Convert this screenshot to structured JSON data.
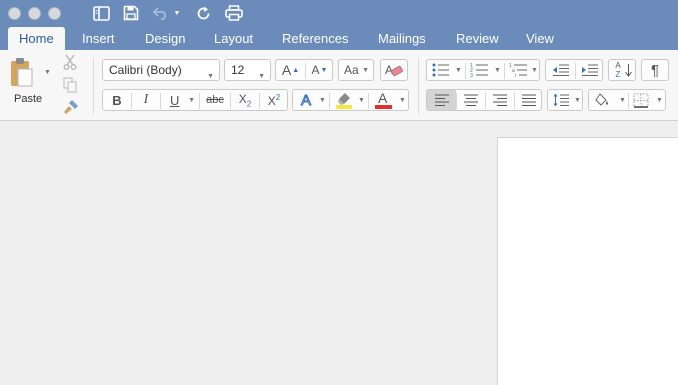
{
  "window": {
    "traffic_lights": [
      "close",
      "minimize",
      "zoom"
    ],
    "quick_access": [
      "sidebar-icon",
      "save-icon",
      "undo-icon",
      "redo-icon",
      "print-icon"
    ]
  },
  "tabs": [
    {
      "label": "Home",
      "active": true
    },
    {
      "label": "Insert"
    },
    {
      "label": "Design"
    },
    {
      "label": "Layout"
    },
    {
      "label": "References"
    },
    {
      "label": "Mailings"
    },
    {
      "label": "Review"
    },
    {
      "label": "View"
    }
  ],
  "clipboard": {
    "paste_label": "Paste"
  },
  "font": {
    "name": "Calibri (Body)",
    "size": "12",
    "bold_glyph": "B",
    "italic_glyph": "I",
    "underline_glyph": "U",
    "strike_glyph": "abc",
    "subscript_base": "X",
    "subscript_mark": "2",
    "superscript_base": "X",
    "superscript_mark": "2",
    "grow_glyph": "A",
    "shrink_glyph": "A",
    "case_glyph": "Aa",
    "effects_glyph": "A",
    "color_glyph": "A",
    "sort_top": "A",
    "sort_bottom": "Z",
    "highlight_color": "#f5ea3c",
    "font_color": "#e03030"
  },
  "paragraph": {
    "alignment_selected": "left",
    "pilcrow_glyph": "¶"
  },
  "colors": {
    "titlebar": "#6b8cba",
    "active_tab_text": "#2f5c9c",
    "ribbon_bg": "#f7f7f7",
    "doc_bg": "#efefef"
  }
}
